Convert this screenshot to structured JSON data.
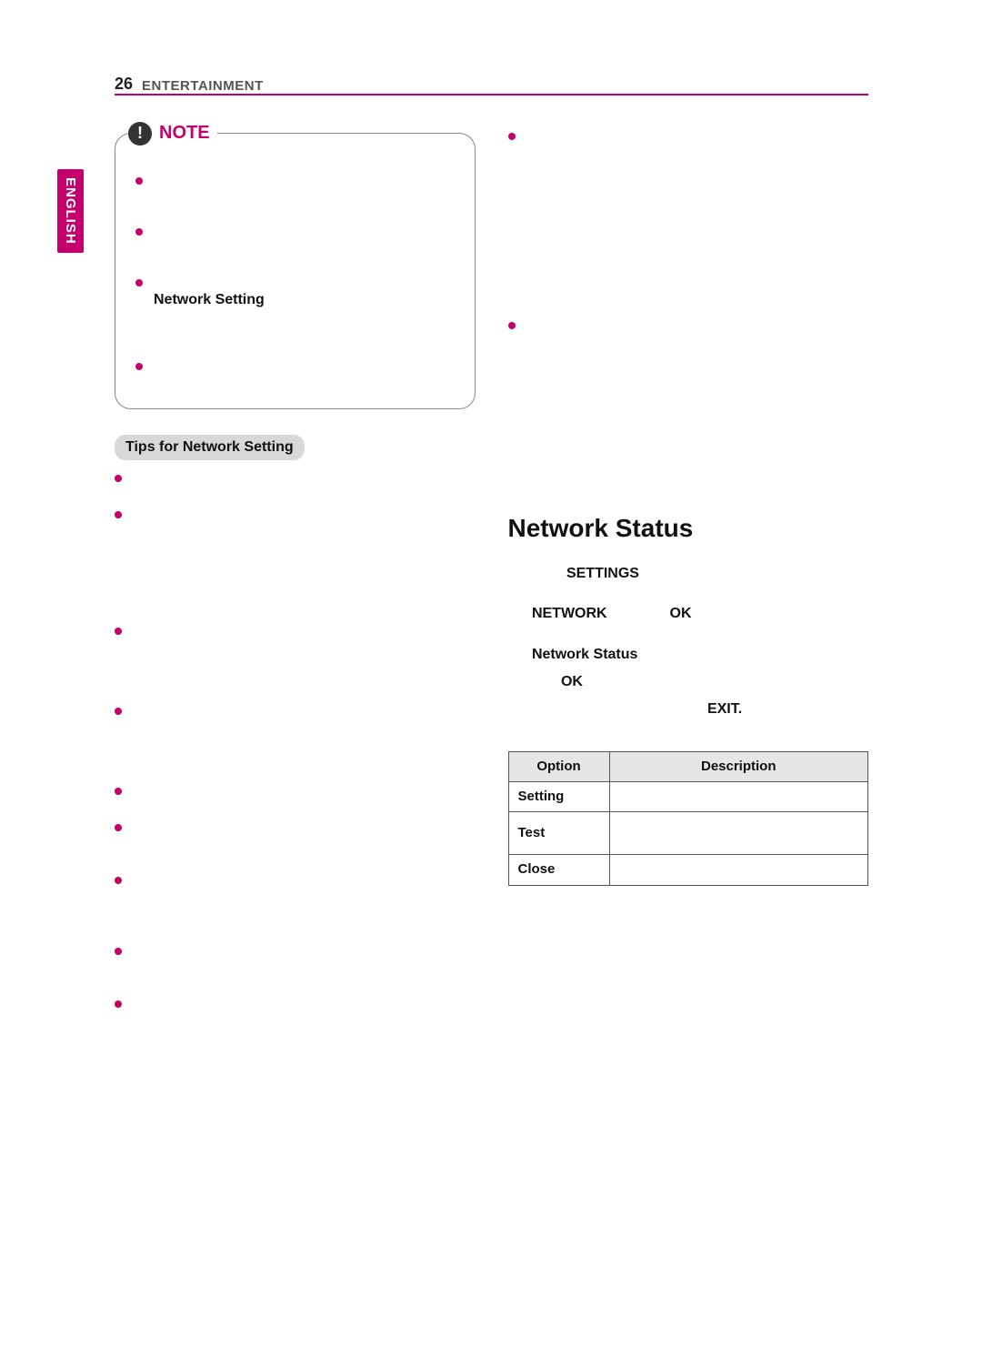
{
  "header": {
    "page_number": "26",
    "section": "ENTERTAINMENT"
  },
  "language_tab": "ENGLISH",
  "note": {
    "title": "NOTE",
    "bold_inline": "Network Setting"
  },
  "tips_heading": "Tips for Network Setting",
  "right": {
    "heading": "Network Status",
    "step1_bold": "SETTINGS",
    "step2_bold_a": "NETWORK",
    "step2_bold_b": "OK",
    "step3_bold_a": "Network Status",
    "step3_bold_b": "OK",
    "step4_bold": "EXIT."
  },
  "table": {
    "headers": {
      "option": "Option",
      "description": "Description"
    },
    "rows": [
      {
        "option": "Setting",
        "description": ""
      },
      {
        "option": "Test",
        "description": ""
      },
      {
        "option": "Close",
        "description": ""
      }
    ]
  }
}
